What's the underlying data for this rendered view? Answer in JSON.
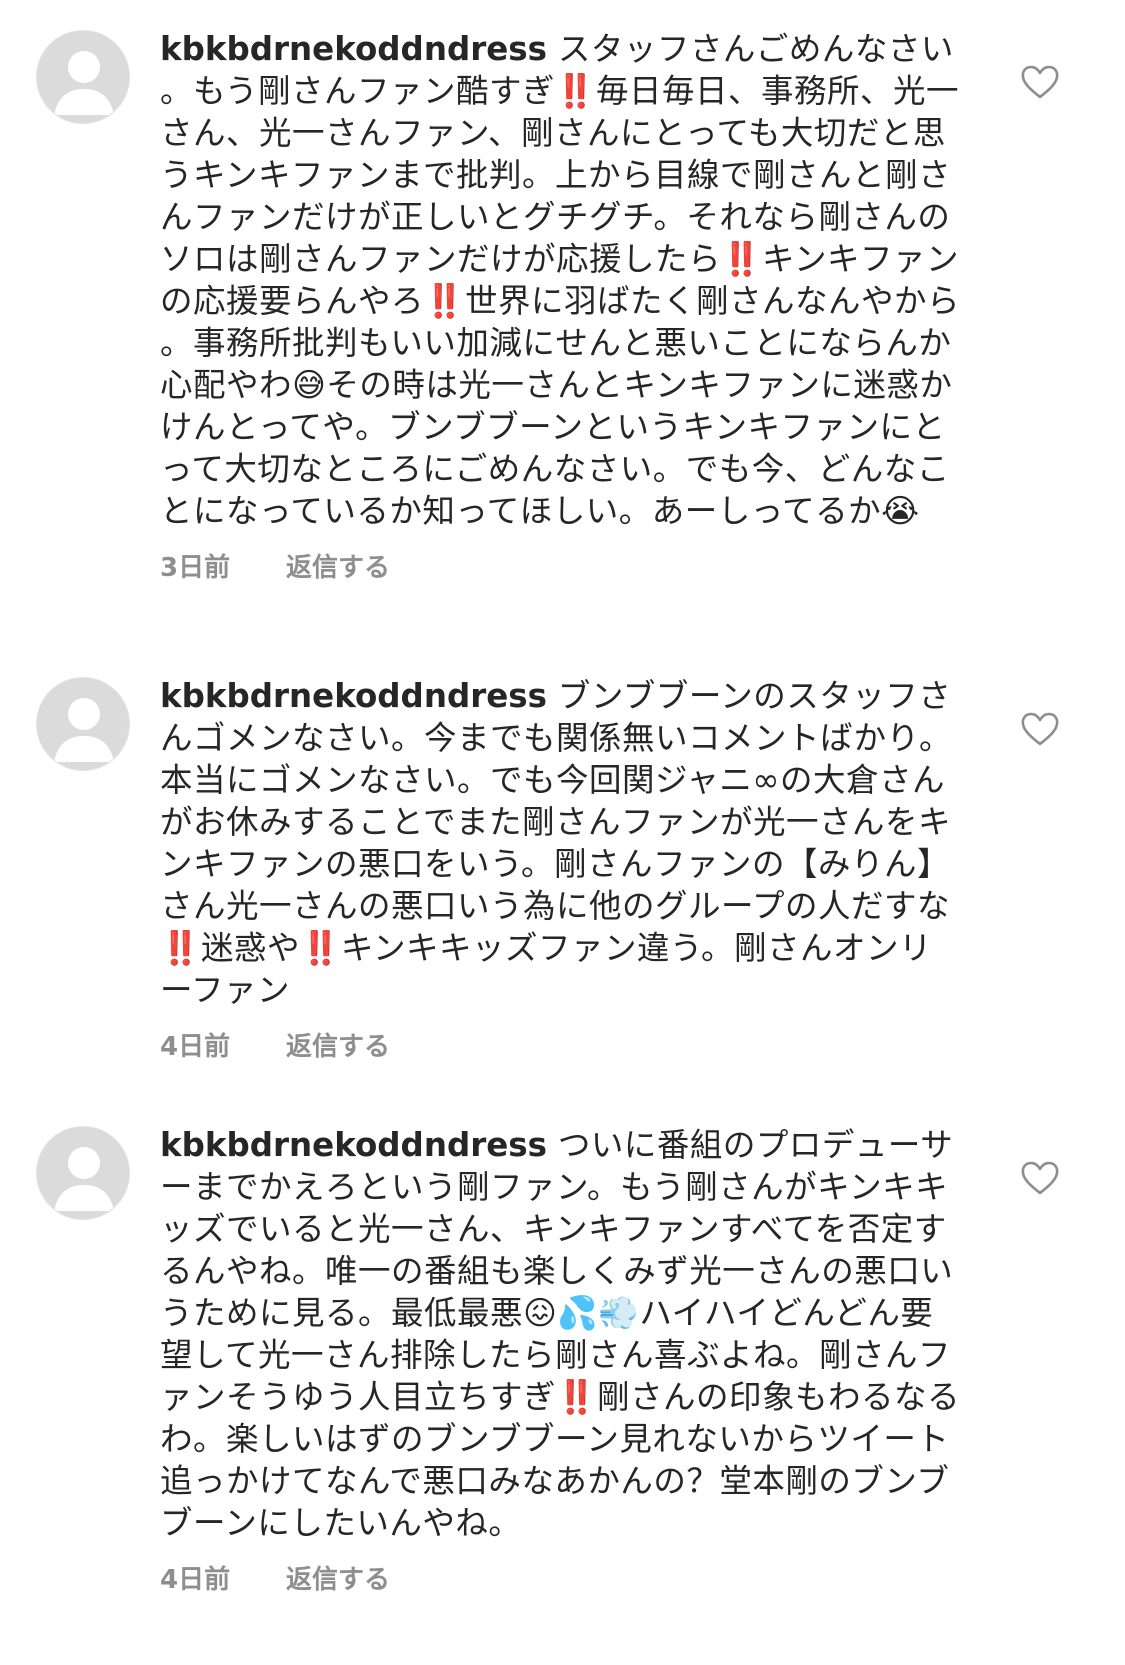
{
  "comments": [
    {
      "username": "kbkbdrnekoddndress",
      "text": "スタッフさんごめんなさい。もう剛さんファン酷すぎ‼️毎日毎日、事務所、光一さん、光一さんファン、剛さんにとっても大切だと思うキンキファンまで批判。上から目線で剛さんと剛さんファンだけが正しいとグチグチ。それなら剛さんのソロは剛さんファンだけが応援したら‼️キンキファンの応援要らんやろ‼️世界に羽ばたく剛さんなんやから。事務所批判もいい加減にせんと悪いことにならんか心配やわ😅その時は光一さんとキンキファンに迷惑かけんとってや。ブンブブーンというキンキファンにとって大切なところにごめんなさい。でも今、どんなことになっているか知ってほしい。あーしってるか😭",
      "time": "3日前",
      "reply_label": "返信する",
      "like_icon": "heart-outline-icon"
    },
    {
      "username": "kbkbdrnekoddndress",
      "text": "ブンブブーンのスタッフさんゴメンなさい。今までも関係無いコメントばかり。本当にゴメンなさい。でも今回関ジャニ∞の大倉さんがお休みすることでまた剛さんファンが光一さんをキンキファンの悪口をいう。剛さんファンの【みりん】さん光一さんの悪口いう為に他のグループの人だすな‼️迷惑や‼️キンキキッズファン違う。剛さんオンリーファン",
      "time": "4日前",
      "reply_label": "返信する",
      "like_icon": "heart-outline-icon"
    },
    {
      "username": "kbkbdrnekoddndress",
      "text": "ついに番組のプロデューサーまでかえろという剛ファン。もう剛さんがキンキキッズでいると光一さん、キンキファンすべてを否定するんやね。唯一の番組も楽しくみず光一さんの悪口いうために見る。最低最悪😖💦💨ハイハイどんどん要望して光一さん排除したら剛さん喜ぶよね。剛さんファンそうゆう人目立ちすぎ‼️剛さんの印象もわるなるわ。楽しいはずのブンブブーン見れないからツイート追っかけてなんで悪口みなあかんの？堂本剛のブンブブーンにしたいんやね。",
      "time": "4日前",
      "reply_label": "返信する",
      "like_icon": "heart-outline-icon"
    }
  ],
  "colors": {
    "text": "#262626",
    "meta": "#8e8e8e",
    "avatar_bg": "#dbdbdb",
    "heart_stroke": "#8e8e8e"
  }
}
